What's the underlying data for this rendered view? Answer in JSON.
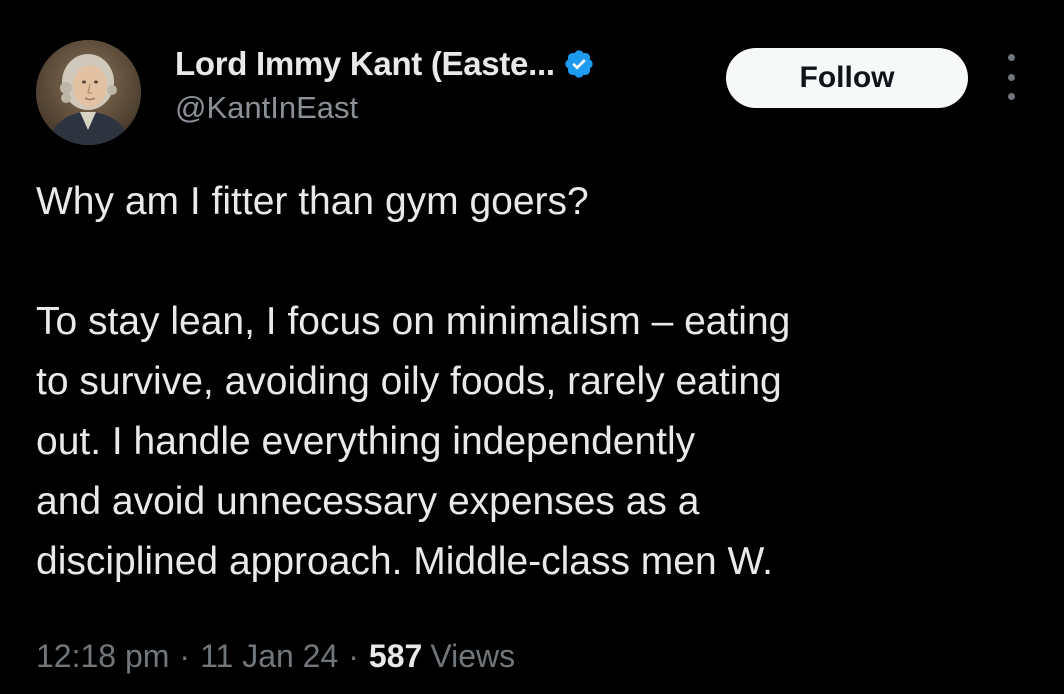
{
  "author": {
    "display_name": "Lord Immy Kant (Easte...",
    "handle": "@KantInEast",
    "verified": true,
    "avatar_icon": "portrait-avatar"
  },
  "actions": {
    "follow_label": "Follow",
    "more_icon": "more-vertical-icon"
  },
  "tweet": {
    "paragraph1": "Why am I fitter than gym goers?",
    "paragraph2_lines": [
      "To stay lean, I focus on minimalism – eating",
      "to survive, avoiding oily foods, rarely eating",
      "out. I handle everything independently",
      "and avoid unnecessary expenses as a",
      "disciplined approach. Middle-class men W."
    ]
  },
  "meta": {
    "time": "12:18 pm",
    "date": "11 Jan 24",
    "views_count": "587",
    "views_label": "Views",
    "separator": "·"
  },
  "colors": {
    "background": "#000000",
    "text_primary": "#e7e9ea",
    "text_secondary": "#71767b",
    "verified_blue": "#1d9bf0",
    "follow_bg": "#f7f9f9"
  }
}
